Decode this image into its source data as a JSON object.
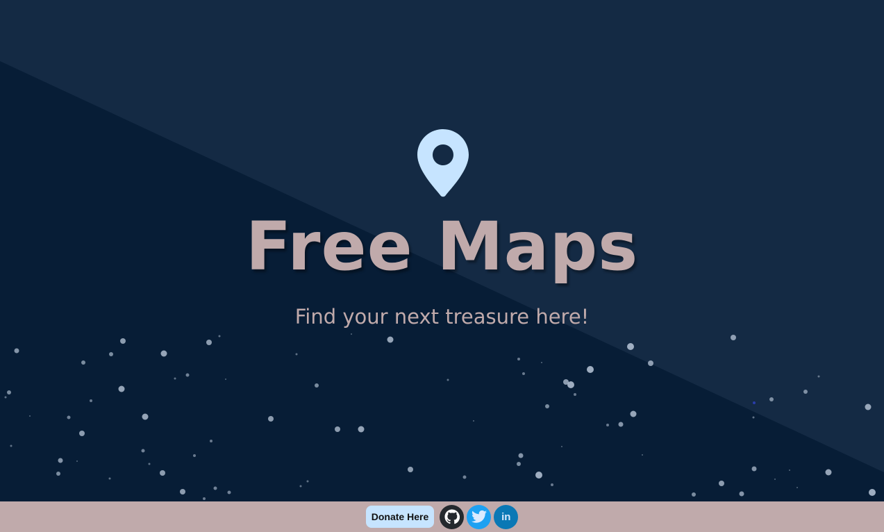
{
  "hero": {
    "title": "Free Maps",
    "subtitle": "Find your next treasure here!",
    "icon": "map-pin-icon"
  },
  "footer": {
    "donate_label": "Donate Here",
    "social": [
      {
        "name": "github",
        "icon": "github-icon",
        "color": "#24292e"
      },
      {
        "name": "twitter",
        "icon": "twitter-icon",
        "color": "#1da1f2"
      },
      {
        "name": "linkedin",
        "icon": "linkedin-icon",
        "label": "in",
        "color": "#0a78b5"
      }
    ]
  },
  "colors": {
    "background_dark": "#071d36",
    "background_light": "#142a44",
    "accent_pin": "#c6e4ff",
    "title_color": "#c0aaab",
    "footer_bg": "#c0aaab",
    "donate_bg": "#c6e4ff"
  }
}
